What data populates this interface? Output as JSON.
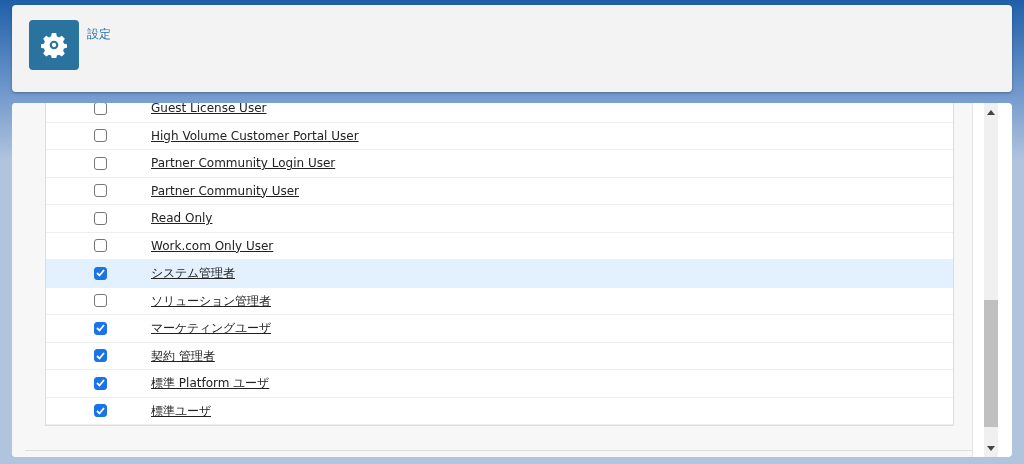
{
  "header": {
    "title": "設定"
  },
  "profiles": [
    {
      "label": "Guest License User",
      "checked": false,
      "highlighted": false
    },
    {
      "label": "High Volume Customer Portal User",
      "checked": false,
      "highlighted": false
    },
    {
      "label": "Partner Community Login User",
      "checked": false,
      "highlighted": false
    },
    {
      "label": "Partner Community User",
      "checked": false,
      "highlighted": false
    },
    {
      "label": "Read Only",
      "checked": false,
      "highlighted": false
    },
    {
      "label": "Work.com Only User",
      "checked": false,
      "highlighted": false
    },
    {
      "label": "システム管理者",
      "checked": true,
      "highlighted": true
    },
    {
      "label": "ソリューション管理者",
      "checked": false,
      "highlighted": false
    },
    {
      "label": "マーケティングユーザ",
      "checked": true,
      "highlighted": false
    },
    {
      "label": "契約 管理者",
      "checked": true,
      "highlighted": false
    },
    {
      "label": "標準 Platform ユーザ",
      "checked": true,
      "highlighted": false
    },
    {
      "label": "標準ユーザ",
      "checked": true,
      "highlighted": false
    }
  ]
}
